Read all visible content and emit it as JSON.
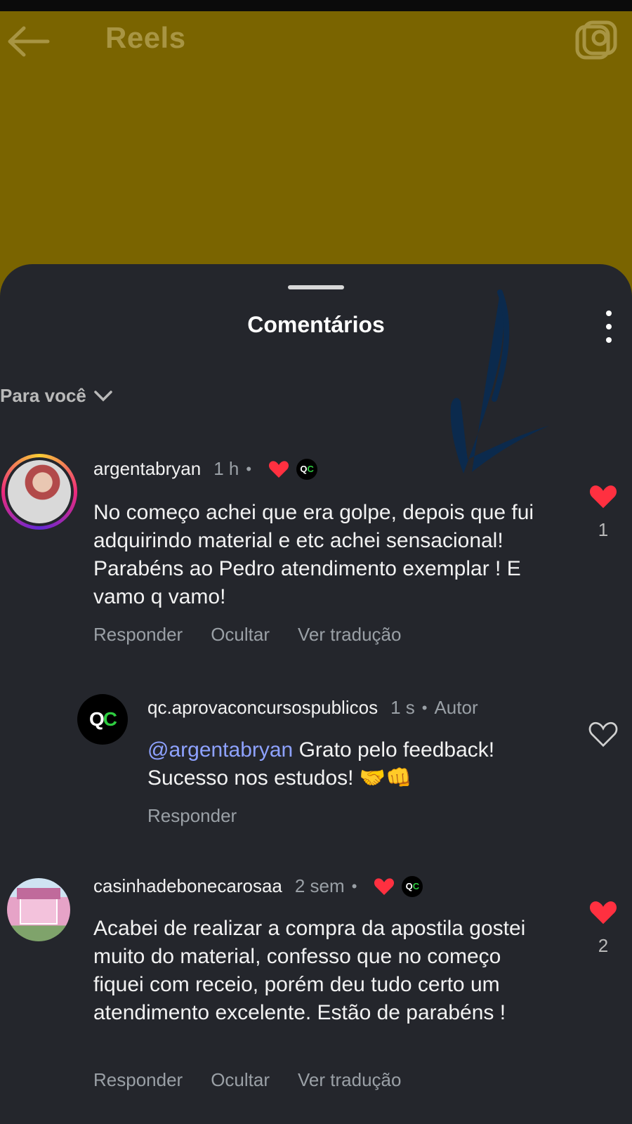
{
  "topbar": {
    "title": "Reels"
  },
  "sheet": {
    "title": "Comentários",
    "filter_label": "Para você"
  },
  "comments": [
    {
      "username": "argentabryan",
      "time": "1 h",
      "text": "No começo achei que era golpe, depois que fui adquirindo material e etc achei sensacional! Parabéns ao Pedro atendimento exemplar ! E vamo q vamo!",
      "like_count": "1",
      "actions": [
        "Responder",
        "Ocultar",
        "Ver tradução"
      ]
    },
    {
      "username": "qc.aprovaconcursospublicos",
      "time": "1 s",
      "author_tag": "Autor",
      "mention": "@argentabryan",
      "text": "Grato pelo feedback! Sucesso nos estudos! 🤝👊",
      "actions": [
        "Responder"
      ]
    },
    {
      "username": "casinhadebonecarosaa",
      "time": "2 sem",
      "text": "Acabei de realizar a compra da apostila gostei muito do material, confesso que no começo fiquei com receio, porém deu tudo certo um atendimento excelente. Estão de parabéns !",
      "like_count": "2",
      "actions": [
        "Responder",
        "Ocultar",
        "Ver tradução"
      ]
    }
  ],
  "badges": {
    "qc_logo_text": "QC"
  },
  "colors": {
    "like_red": "#ff3040",
    "mention_blue": "#8ea2ff",
    "reel_bg": "#7a6400",
    "sheet_bg": "#24262c"
  }
}
